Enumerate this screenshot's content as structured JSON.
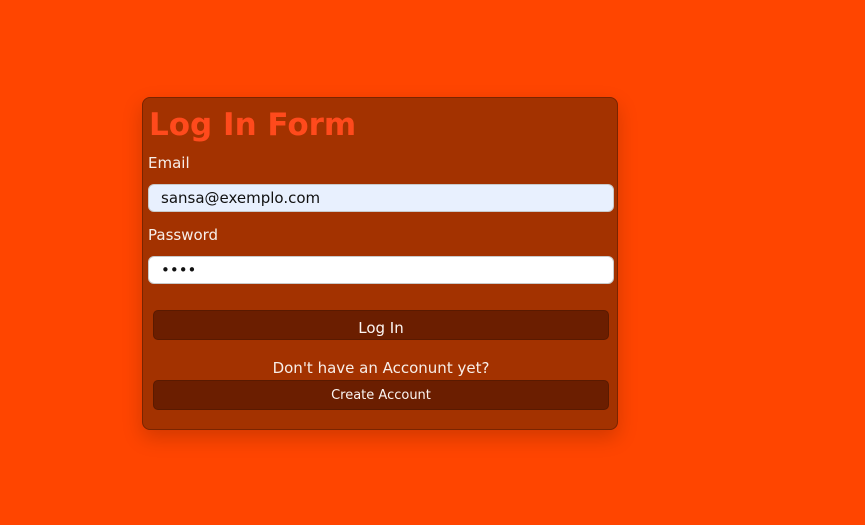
{
  "form": {
    "title": "Log In Form",
    "email_label": "Email",
    "email_value": "sansa@exemplo.com",
    "password_label": "Password",
    "password_value": "abcd",
    "login_label": "Log In",
    "no_account_text": "Don't have an Acconunt yet?",
    "create_account_label": "Create Account"
  },
  "colors": {
    "page_background": "#ff4500",
    "card_background": "#a33200",
    "title": "#ff4a1c",
    "button_background": "#6b1e00",
    "email_field_background": "#e8f0fe"
  }
}
